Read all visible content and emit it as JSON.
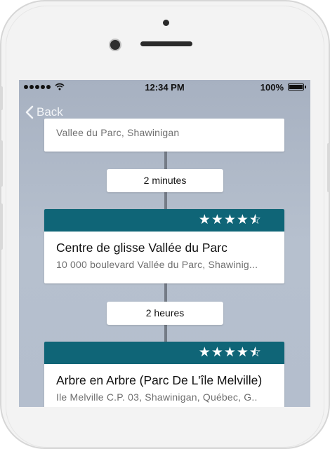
{
  "status_bar": {
    "time": "12:34 PM",
    "battery": "100%"
  },
  "nav": {
    "back_label": "Back"
  },
  "itinerary": {
    "previous_stop_address": "Vallee du Parc, Shawinigan",
    "legs": [
      {
        "duration": "2 minutes"
      },
      {
        "duration": "2 heures"
      }
    ],
    "stops": [
      {
        "name": "Centre de glisse Vallée du Parc",
        "address": "10 000 boulevard Vallée du Parc, Shawinig...",
        "rating": 4.5
      },
      {
        "name": "Arbre en Arbre (Parc De L'île Melville)",
        "address": "Ile Melville C.P. 03, Shawinigan, Québec, G..",
        "rating": 4.5
      }
    ]
  },
  "colors": {
    "header": "#0f6577",
    "screen_bg": "#b4becd",
    "timeline": "#747b86"
  }
}
